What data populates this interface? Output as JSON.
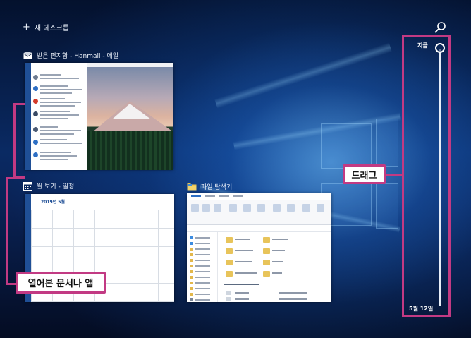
{
  "timeline": {
    "new_desktop_label": "새 데스크톱",
    "windows": [
      {
        "id": "mail",
        "title": "받은 편지함 - Hanmail - 메일",
        "icon": "mail-icon"
      },
      {
        "id": "calendar",
        "title": "월 보기 - 일정",
        "icon": "calendar-icon"
      },
      {
        "id": "explorer",
        "title": "파일 탐색기",
        "icon": "folder-icon"
      }
    ],
    "rail": {
      "now_label": "지금",
      "date_label": "5월 12일"
    },
    "bottom_text": "",
    "calendar_month": "2019년 5월"
  },
  "callouts": {
    "drag": "드래그",
    "opened": "열어본 문서나 앱"
  },
  "colors": {
    "accent": "#c23a83",
    "background": "#0a2a63",
    "text": "#ffffff"
  }
}
